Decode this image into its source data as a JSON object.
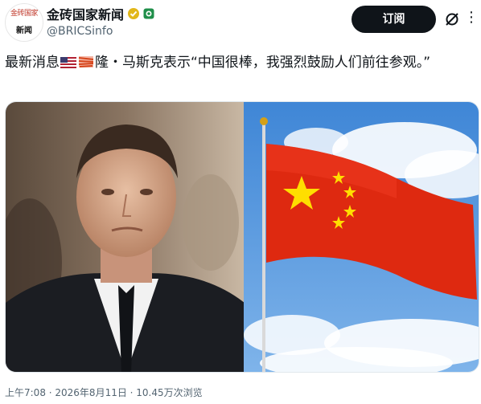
{
  "account": {
    "avatar_top": "金砖国家",
    "avatar_bottom": "新闻",
    "display_name": "金砖国家新闻",
    "handle": "@BRICSinfo"
  },
  "header": {
    "subscribe_label": "订阅",
    "more_label": "⋮"
  },
  "post": {
    "text_part1": "最新消息",
    "text_part2": "隆・马斯克表示“中国很棒，我强烈鼓励人们前往参观。”"
  },
  "media": {
    "left_image": "portrait-photo",
    "right_image": "china-flag-photo"
  },
  "meta": {
    "line": "上午7:08 · 2026年8月11日 · 10.45万次浏览"
  },
  "colors": {
    "text": "#0f1419",
    "muted": "#536471",
    "button_bg": "#0f1419",
    "flag_red": "#de2910",
    "flag_yellow": "#ffde00",
    "sky": "#4a8fd6"
  }
}
